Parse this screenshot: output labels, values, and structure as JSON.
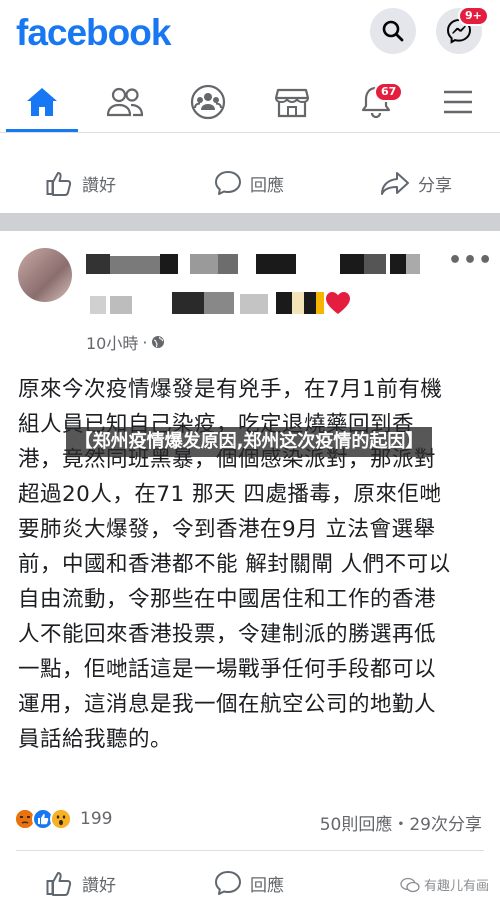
{
  "header": {
    "logo": "facebook",
    "messenger_badge": "9+"
  },
  "nav": {
    "items": [
      {
        "icon": "home-icon",
        "active": true
      },
      {
        "icon": "friends-icon"
      },
      {
        "icon": "groups-icon"
      },
      {
        "icon": "marketplace-icon"
      },
      {
        "icon": "notifications-icon",
        "badge": "67"
      },
      {
        "icon": "menu-icon"
      }
    ]
  },
  "top_actions": {
    "like": "讚好",
    "comment": "回應",
    "share": "分享"
  },
  "post": {
    "time": "10小時",
    "text": "原來今次疫情爆發是有兇手，在7月1前有機\n組人員已知自己染疫，吃定退燒藥回到香\n港，竟然同班黑暴，個個感染派對，那派對\n超過20人，在71 那天 四處播毒，原來佢哋\n要肺炎大爆發，令到香港在9月 立法會選舉\n前，中國和香港都不能 解封關閘 人們不可以\n自由流動，令那些在中國居住和工作的香港\n人不能回來香港投票，令建制派的勝選再低\n一點，佢哋話這是一場戰爭任何手段都可以\n運用，這消息是我一個在航空公司的地勤人\n員話給我聽的。",
    "overlay_title": "【郑州疫情爆发原因,郑州这次疫情的起因】",
    "reaction_count": "199",
    "stats": "50則回應・29次分享"
  },
  "bottom_actions": {
    "like": "讚好",
    "comment": "回應"
  },
  "watermark": "有趣儿有画",
  "colors": {
    "brand": "#1877f2",
    "badge": "#e41e3f",
    "muted": "#65676b"
  }
}
